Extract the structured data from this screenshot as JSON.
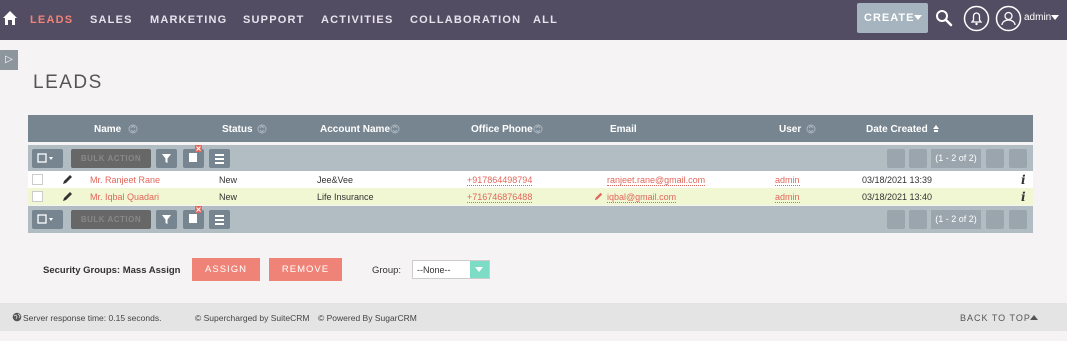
{
  "nav": {
    "items": [
      "LEADS",
      "SALES",
      "MARKETING",
      "SUPPORT",
      "ACTIVITIES",
      "COLLABORATION",
      "ALL"
    ],
    "active_index": 0,
    "create_label": "CREATE",
    "user_name": "admin"
  },
  "page": {
    "title": "LEADS"
  },
  "table": {
    "columns": [
      "Name",
      "Status",
      "Account Name",
      "Office Phone",
      "Email",
      "User",
      "Date Created"
    ],
    "bulk_action_label": "BULK ACTION",
    "pagination": "(1 - 2 of 2)",
    "rows": [
      {
        "name": "Mr. Ranjeet Rane",
        "status": "New",
        "account": "Jee&Vee",
        "phone": "+917864498794",
        "email": "ranjeet.rane@gmail.com",
        "user": "admin",
        "date": "03/18/2021 13:39"
      },
      {
        "name": "Mr. Iqbal Quadari",
        "status": "New",
        "account": "Life Insurance",
        "phone": "+716746876488",
        "email": "iqbal@gmail.com",
        "user": "admin",
        "date": "03/18/2021 13:40"
      }
    ]
  },
  "mass_assign": {
    "label": "Security Groups: Mass Assign",
    "assign_label": "ASSIGN",
    "remove_label": "REMOVE",
    "group_label": "Group:",
    "group_value": "--None--"
  },
  "footer": {
    "response_time": "Server response time: 0.15 seconds.",
    "supercharged": "© Supercharged by SuiteCRM",
    "powered": "© Powered By SugarCRM",
    "back_to_top": "BACK TO TOP"
  },
  "colors": {
    "nav_bg": "#534d64",
    "accent": "#f08377",
    "header_bg": "#778591"
  }
}
